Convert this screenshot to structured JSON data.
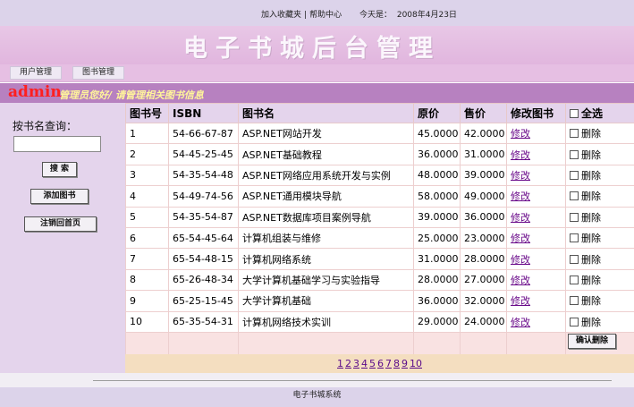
{
  "topbar": {
    "favorites": "加入收藏夹",
    "separator": "|",
    "help": "帮助中心",
    "today_label": "今天是：",
    "today_value": "2008年4月23日"
  },
  "banner": {
    "title": "电子书城后台管理"
  },
  "nav": {
    "users": "用户管理",
    "books": "图书管理"
  },
  "welcome": {
    "user": "admin",
    "message": "管理员您好/ 请管理相关图书信息"
  },
  "sidebar": {
    "search_label": "按书名查询：",
    "search_value": "",
    "search_button": "搜 索",
    "add_button": "添加图书",
    "logout_button": "注销回首页"
  },
  "table": {
    "headers": {
      "id": "图书号",
      "isbn": "ISBN",
      "name": "图书名",
      "price": "原价",
      "sale": "售价",
      "edit": "修改图书",
      "select_all": "全选"
    },
    "rows": [
      {
        "id": "1",
        "isbn": "54-66-67-87",
        "name": "ASP.NET网站开发",
        "price": "45.0000",
        "sale": "42.0000",
        "edit": "修改",
        "del": "删除"
      },
      {
        "id": "2",
        "isbn": "54-45-25-45",
        "name": "ASP.NET基础教程",
        "price": "36.0000",
        "sale": "31.0000",
        "edit": "修改",
        "del": "删除"
      },
      {
        "id": "3",
        "isbn": "54-35-54-48",
        "name": "ASP.NET网络应用系统开发与实例",
        "price": "48.0000",
        "sale": "39.0000",
        "edit": "修改",
        "del": "删除"
      },
      {
        "id": "4",
        "isbn": "54-49-74-56",
        "name": "ASP.NET通用模块导航",
        "price": "58.0000",
        "sale": "49.0000",
        "edit": "修改",
        "del": "删除"
      },
      {
        "id": "5",
        "isbn": "54-35-54-87",
        "name": "ASP.NET数据库项目案例导航",
        "price": "39.0000",
        "sale": "36.0000",
        "edit": "修改",
        "del": "删除"
      },
      {
        "id": "6",
        "isbn": "65-54-45-64",
        "name": "计算机组装与维修",
        "price": "25.0000",
        "sale": "23.0000",
        "edit": "修改",
        "del": "删除"
      },
      {
        "id": "7",
        "isbn": "65-54-48-15",
        "name": "计算机网络系统",
        "price": "31.0000",
        "sale": "28.0000",
        "edit": "修改",
        "del": "删除"
      },
      {
        "id": "8",
        "isbn": "65-26-48-34",
        "name": "大学计算机基础学习与实验指导",
        "price": "28.0000",
        "sale": "27.0000",
        "edit": "修改",
        "del": "删除"
      },
      {
        "id": "9",
        "isbn": "65-25-15-45",
        "name": "大学计算机基础",
        "price": "36.0000",
        "sale": "32.0000",
        "edit": "修改",
        "del": "删除"
      },
      {
        "id": "10",
        "isbn": "65-35-54-31",
        "name": "计算机网络技术实训",
        "price": "29.0000",
        "sale": "24.0000",
        "edit": "修改",
        "del": "删除"
      }
    ],
    "confirm_delete": "确认删除"
  },
  "pager": {
    "pages": [
      "1",
      "2",
      "3",
      "4",
      "5",
      "6",
      "7",
      "8",
      "9",
      "10"
    ]
  },
  "footer": {
    "text": "电子书城系统"
  }
}
